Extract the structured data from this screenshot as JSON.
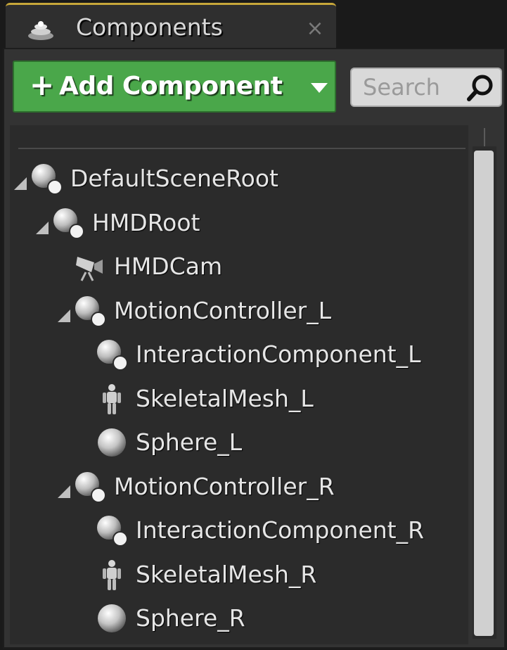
{
  "tab": {
    "title": "Components",
    "icon": "components-icon",
    "close_icon": "close-icon"
  },
  "toolbar": {
    "add_label": "Add Component",
    "add_plus": "+",
    "search_placeholder": "Search"
  },
  "tree": [
    {
      "label": "DefaultSceneRoot",
      "depth": 0,
      "expanded": true,
      "icon": "scene-component-icon"
    },
    {
      "label": "HMDRoot",
      "depth": 1,
      "expanded": true,
      "icon": "scene-component-icon"
    },
    {
      "label": "HMDCam",
      "depth": 2,
      "expanded": false,
      "icon": "camera-icon"
    },
    {
      "label": "MotionController_L",
      "depth": 2,
      "expanded": true,
      "icon": "scene-component-icon"
    },
    {
      "label": "InteractionComponent_L",
      "depth": 3,
      "expanded": false,
      "icon": "scene-component-icon"
    },
    {
      "label": "SkeletalMesh_L",
      "depth": 3,
      "expanded": false,
      "icon": "skeletal-mesh-icon"
    },
    {
      "label": "Sphere_L",
      "depth": 3,
      "expanded": false,
      "icon": "sphere-icon"
    },
    {
      "label": "MotionController_R",
      "depth": 2,
      "expanded": true,
      "icon": "scene-component-icon"
    },
    {
      "label": "InteractionComponent_R",
      "depth": 3,
      "expanded": false,
      "icon": "scene-component-icon"
    },
    {
      "label": "SkeletalMesh_R",
      "depth": 3,
      "expanded": false,
      "icon": "skeletal-mesh-icon"
    },
    {
      "label": "Sphere_R",
      "depth": 3,
      "expanded": false,
      "icon": "sphere-icon"
    }
  ],
  "colors": {
    "add_button": "#4aa74a",
    "panel": "#333333",
    "tree_bg": "#2b2b2b",
    "text": "#e6e6e6"
  }
}
